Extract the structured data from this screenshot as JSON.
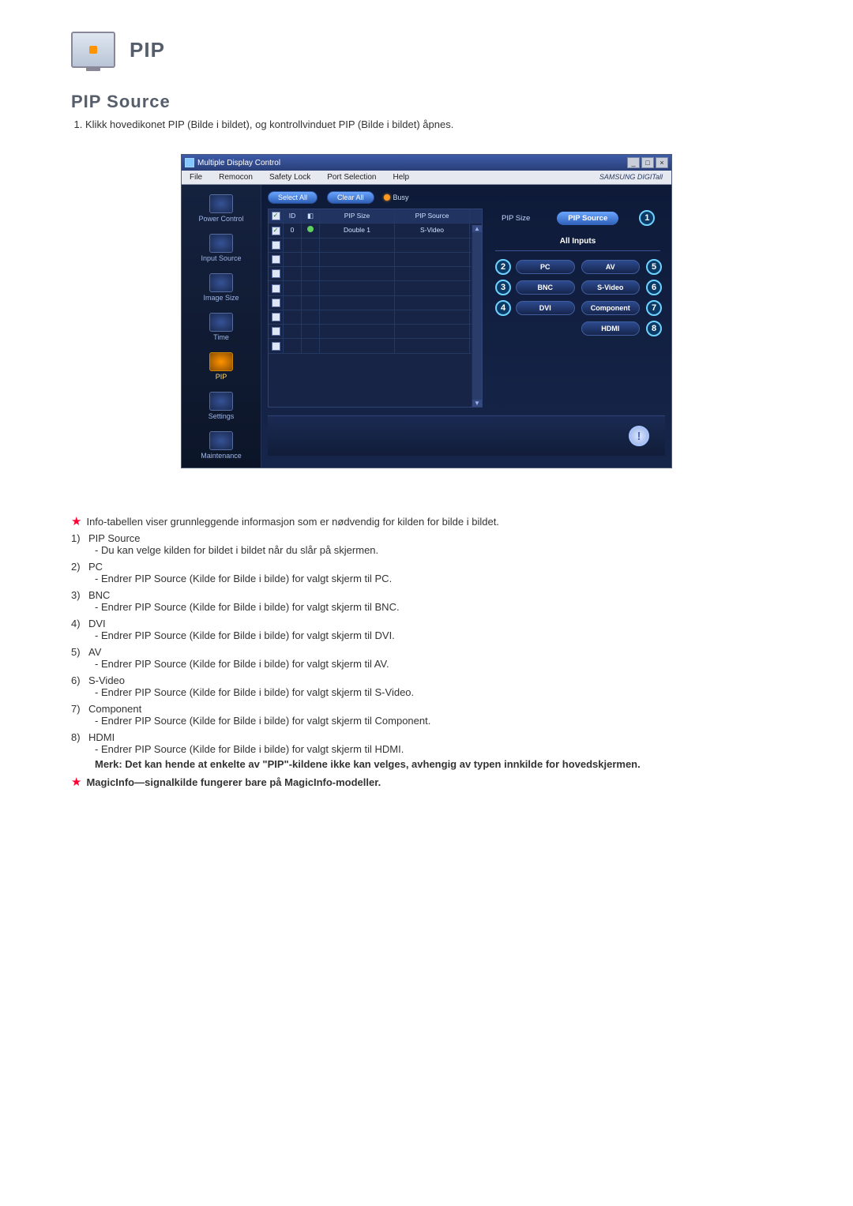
{
  "header": {
    "title": "PIP",
    "subtitle": "PIP Source",
    "intro_1": "Klikk hovedikonet PIP (Bilde i bildet), og kontrollvinduet PIP (Bilde i bildet) åpnes."
  },
  "app": {
    "window_title": "Multiple Display Control",
    "menu": {
      "file": "File",
      "remocon": "Remocon",
      "safety": "Safety Lock",
      "port": "Port Selection",
      "help": "Help"
    },
    "brand": "SAMSUNG DIGITall",
    "sidebar": {
      "power": "Power Control",
      "input": "Input Source",
      "image": "Image Size",
      "time": "Time",
      "pip": "PIP",
      "settings": "Settings",
      "maintenance": "Maintenance"
    },
    "toolbar": {
      "select_all": "Select All",
      "clear_all": "Clear All",
      "busy": "Busy"
    },
    "grid": {
      "col_id": "ID",
      "col_pipsize": "PIP Size",
      "col_pipsource": "PIP Source",
      "row1": {
        "id": "0",
        "size": "Double 1",
        "source": "S-Video"
      }
    },
    "panel": {
      "tab_size": "PIP Size",
      "tab_source": "PIP Source",
      "all_inputs": "All Inputs",
      "pc": "PC",
      "av": "AV",
      "bnc": "BNC",
      "svideo": "S-Video",
      "dvi": "DVI",
      "component": "Component",
      "hdmi": "HDMI"
    },
    "callouts": {
      "c1": "1",
      "c2": "2",
      "c3": "3",
      "c4": "4",
      "c5": "5",
      "c6": "6",
      "c7": "7",
      "c8": "8"
    }
  },
  "notes": {
    "star1": "Info-tabellen viser grunnleggende informasjon som er nødvendig for kilden for bilde i bildet.",
    "items": [
      {
        "n": "1)",
        "title": "PIP Source",
        "desc": "Du kan velge kilden for bildet i bildet når du slår på skjermen."
      },
      {
        "n": "2)",
        "title": "PC",
        "desc": "Endrer PIP Source (Kilde for Bilde i bilde) for valgt skjerm til PC."
      },
      {
        "n": "3)",
        "title": "BNC",
        "desc": "Endrer PIP Source (Kilde for Bilde i bilde) for valgt skjerm til BNC."
      },
      {
        "n": "4)",
        "title": "DVI",
        "desc": "Endrer PIP Source (Kilde for Bilde i bilde) for valgt skjerm til DVI."
      },
      {
        "n": "5)",
        "title": "AV",
        "desc": "Endrer PIP Source (Kilde for Bilde i bilde) for valgt skjerm til AV."
      },
      {
        "n": "6)",
        "title": "S-Video",
        "desc": "Endrer PIP Source (Kilde for Bilde i bilde) for valgt skjerm til S-Video."
      },
      {
        "n": "7)",
        "title": "Component",
        "desc": "Endrer PIP Source (Kilde for Bilde i bilde) for valgt skjerm til Component."
      },
      {
        "n": "8)",
        "title": "HDMI",
        "desc": "Endrer PIP Source (Kilde for Bilde i bilde) for valgt skjerm til HDMI."
      }
    ],
    "merk": "Merk: Det kan hende at enkelte av \"PIP\"-kildene ikke kan velges, avhengig av typen innkilde for hovedskjermen.",
    "star2": "MagicInfo—signalkilde fungerer bare på MagicInfo-modeller."
  }
}
